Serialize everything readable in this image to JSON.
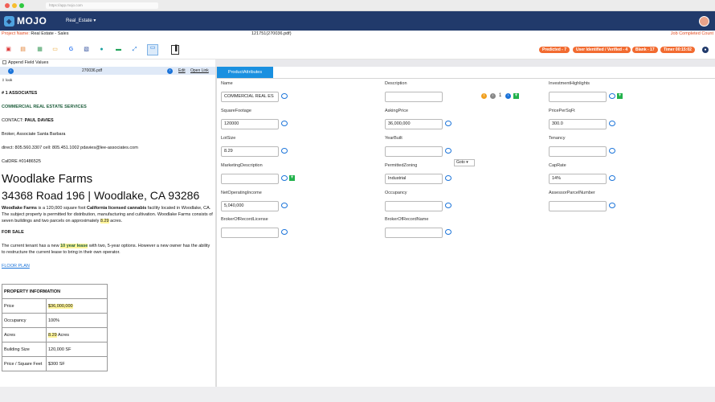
{
  "browser": {
    "url": "https://app.mojo.com"
  },
  "app": {
    "logo": "MOJO",
    "project_dropdown": "Real_Estate"
  },
  "infobar": {
    "project_label": "Project Name:",
    "project_value": "Real Estate - Sales",
    "file": "121751(270036.pdf)",
    "job_status": "Job Completed Count"
  },
  "status_pills": {
    "predicted": "Predicted - 7",
    "user_identified": "User Identified / Verified - 4",
    "blank": "Blank - 17",
    "timer": "Timer 00:15:02"
  },
  "append": {
    "label": "Append Field Values"
  },
  "docbar": {
    "filename": "270036.pdf",
    "link1": "Edit",
    "link2": "Open Link"
  },
  "doc": {
    "tiny": "look",
    "line1": "# 1 ASSOCIATES",
    "line2": "COMMERCIAL REAL ESTATE SERVICES",
    "contact_label": "CONTACT: ",
    "contact_name": "PAUL DAVIES",
    "line4": "Broker, Associate Santa Barbara",
    "line5": "direct: 805.560.3307 cell: 805.451.1002 pdavies@lee-associates.com",
    "line6": "CalDRE #01486525",
    "title": "Woodlake Farms",
    "address": "34368 Road 196 | Woodlake, CA 93286",
    "p1_b1": "Woodlake Farms",
    "p1_t1": " is a 120,000 square foot ",
    "p1_b2": "California licensed cannabis",
    "p1_t2": " facility located in Woodlake, CA. The subject property is permitted for distribution, manufacturing and cultivation. Woodlake Farms consists of seven buildings and two parcels on approximately ",
    "p1_hl": "8.29",
    "p1_t3": " acres.",
    "forsale": "FOR SALE",
    "p2_t1": "The current tenant has a new ",
    "p2_hl": "10 year lease",
    "p2_t2": " with two, 5-year options. However a new owner has the ability to restructure the current lease to bring in their own operator.",
    "floorplan": "FLOOR PLAN",
    "table_header": "PROPERTY INFORMATION",
    "rows": [
      {
        "k": "Price",
        "v": "$36,000,000",
        "hl": true
      },
      {
        "k": "Occupancy",
        "v": "100%",
        "hl": false
      },
      {
        "k": "Acres",
        "v": "8.29",
        "v2": " Acres",
        "hl": true
      },
      {
        "k": "Building Size",
        "v": "120,000 SF",
        "hl": false
      },
      {
        "k": "Price / Square Feet",
        "v": "$300 SF",
        "hl": false
      }
    ]
  },
  "panel": {
    "tab": "ProductAttributes",
    "goto": "Goto",
    "page": "1"
  },
  "fields": {
    "name": {
      "label": "Name",
      "value": "COMMERCIAL REAL ES"
    },
    "description": {
      "label": "Description",
      "value": ""
    },
    "investment": {
      "label": "InvestmentHighlights",
      "value": ""
    },
    "sqft": {
      "label": "SquareFootage",
      "value": "120000"
    },
    "asking": {
      "label": "AskingPrice",
      "value": "36,000,000"
    },
    "ppsf": {
      "label": "PricePerSqFt",
      "value": "300.0"
    },
    "lotsize": {
      "label": "LotSize",
      "value": "8.29"
    },
    "yearbuilt": {
      "label": "YearBuilt",
      "value": ""
    },
    "tenancy": {
      "label": "Tenancy",
      "value": ""
    },
    "marketing": {
      "label": "MarketingDescription",
      "value": ""
    },
    "zoning": {
      "label": "PermittedZoning",
      "value": "Industrial"
    },
    "caprate": {
      "label": "CapRate",
      "value": "14%"
    },
    "noi": {
      "label": "NetOperatingIncome",
      "value": "5,040,000"
    },
    "occupancy": {
      "label": "Occupancy",
      "value": ""
    },
    "apn": {
      "label": "AssessorParcelNumber",
      "value": ""
    },
    "broker_license": {
      "label": "BrokerOfRecordLicense",
      "value": ""
    },
    "broker_name": {
      "label": "BrokerOfRecordName",
      "value": ""
    }
  },
  "colors": {
    "navbar": "#213a6b",
    "accent": "#1a90e0",
    "pill": "#f26b30",
    "highlight": "#fff59a"
  }
}
